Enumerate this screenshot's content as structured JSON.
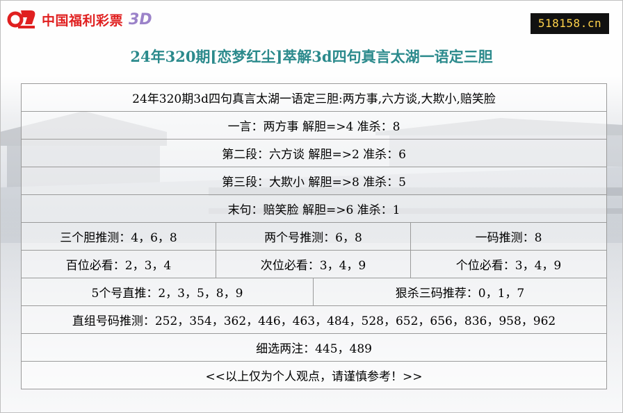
{
  "header": {
    "logo_text": "中国福利彩票",
    "logo_suffix": "3D",
    "site_badge": "518158.cn",
    "brand_color": "#e02020",
    "title": "24年320期[恋梦红尘]萃解3d四句真言太湖一语定三胆",
    "title_color": "#2b8a8c"
  },
  "table": {
    "intro": "24年320期3d四句真言太湖一语定三胆:两方事,六方谈,大欺小,赔笑脸",
    "line1": "一言：两方事 解胆=>4 准杀：8",
    "line2": "第二段：六方谈 解胆=>2 准杀：6",
    "line3": "第三段：大欺小 解胆=>8 准杀：5",
    "line4": "末句：赔笑脸 解胆=>6 准杀：1",
    "three_dan": "三个胆推测：4，6，8",
    "two_num": "两个号推测：6，8",
    "one_code": "一码推测：8",
    "hundreds": "百位必看：2，3，4",
    "tens": "次位必看：3，4，9",
    "units": "个位必看：3，4，9",
    "five_num": "5个号直推：2，3，5，8，9",
    "kill_three": "狠杀三码推荐：0，1，7",
    "group_nums": "直组号码推测：252，354，362，446，463，484，528，652，656，836，958，962",
    "two_bets": "细选两注：445，489",
    "disclaimer": "<<以上仅为个人观点，请谨慎参考！>>"
  }
}
